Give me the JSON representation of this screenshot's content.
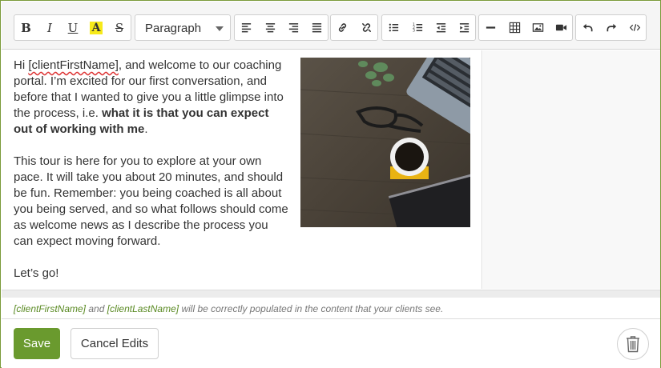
{
  "toolbar": {
    "format_buttons": [
      {
        "glyph": "B",
        "icon": "bold-icon"
      },
      {
        "glyph": "I",
        "icon": "italic-icon"
      },
      {
        "glyph": "U",
        "icon": "underline-icon"
      },
      {
        "glyph": "A",
        "icon": "highlight-icon"
      },
      {
        "glyph": "S",
        "icon": "strikethrough-icon"
      }
    ],
    "block_format": "Paragraph",
    "align_icons": [
      "align-left-icon",
      "align-center-icon",
      "align-right-icon",
      "align-justify-icon"
    ],
    "link_icons": [
      "link-icon",
      "unlink-icon"
    ],
    "list_icons": [
      "bullet-list-icon",
      "numbered-list-icon",
      "outdent-icon",
      "indent-icon"
    ],
    "insert_icons": [
      "horizontal-rule-icon",
      "table-icon",
      "image-icon",
      "video-icon"
    ],
    "history_icons": [
      "undo-icon",
      "redo-icon",
      "code-view-icon"
    ],
    "highlight_color": "#f7ea1a"
  },
  "content": {
    "p1_before": "Hi ",
    "p1_var": "[clientFirstName]",
    "p1_after": ", and welcome to our coaching portal.  I’m excited for our first conversation, and before that I wanted to give you a little glimpse into the process, i.e. ",
    "p1_bold": "what it is that you can expect out of working with me",
    "p1_end": ".",
    "p2": "This tour is here for you to explore at your own pace.  It will take you about 20 minutes, and should be fun.  Remember: you being coached is all about you being served, and so what follows should come as welcome news as I describe the process you can expect moving forward.",
    "p3": "Let’s go!"
  },
  "note": {
    "var1": "[clientFirstName]",
    "and": " and ",
    "var2": "[clientLastName]",
    "rest": " will be correctly populated in the content that your clients see."
  },
  "footer": {
    "save_label": "Save",
    "cancel_label": "Cancel Edits",
    "trash_icon": "trash-icon"
  },
  "colors": {
    "accent": "#6a9a2e",
    "border": "#7a9a3a",
    "variable": "#5a8a23"
  }
}
